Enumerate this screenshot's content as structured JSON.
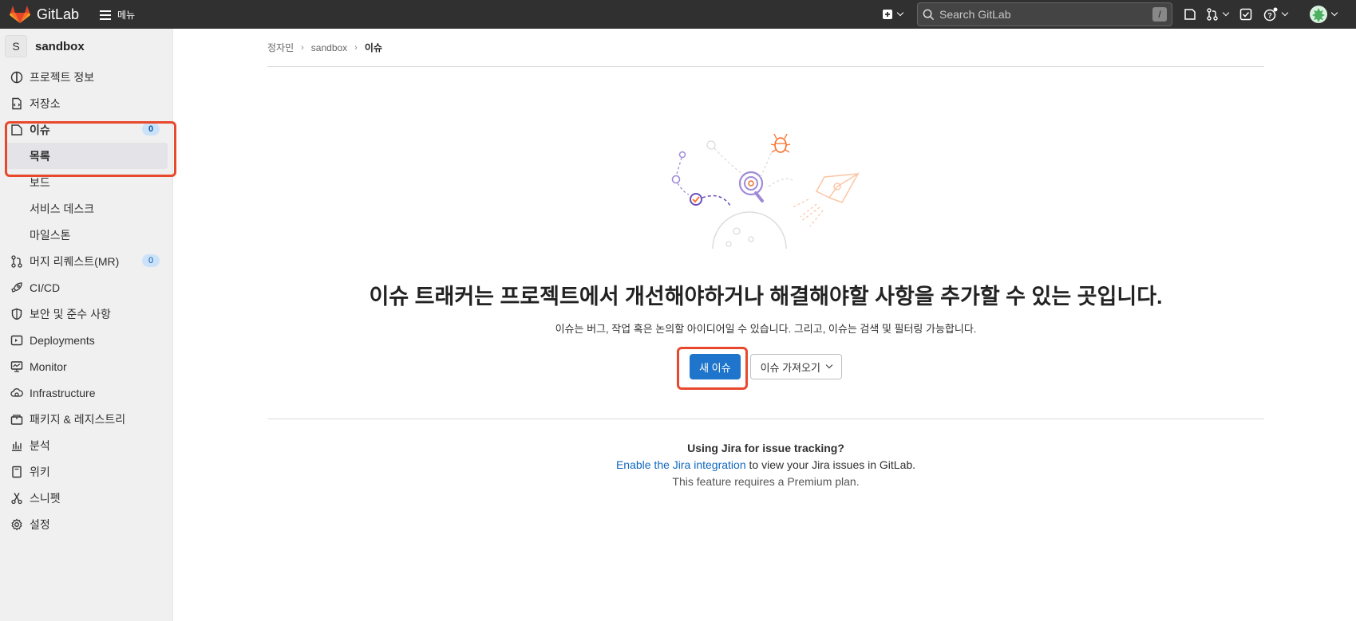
{
  "topbar": {
    "logo_text": "GitLab",
    "menu_label": "메뉴",
    "search_placeholder": "Search GitLab",
    "search_shortcut": "/"
  },
  "sidebar": {
    "project_initial": "S",
    "project_name": "sandbox",
    "items": [
      {
        "label": "프로젝트 정보",
        "icon": "project-info-icon"
      },
      {
        "label": "저장소",
        "icon": "repository-icon"
      },
      {
        "label": "이슈",
        "icon": "issues-icon",
        "badge": "0"
      },
      {
        "label": "목록"
      },
      {
        "label": "보드"
      },
      {
        "label": "서비스 데스크"
      },
      {
        "label": "마일스톤"
      },
      {
        "label": "머지 리퀘스트(MR)",
        "icon": "merge-request-icon",
        "badge": "0"
      },
      {
        "label": "CI/CD",
        "icon": "rocket-icon"
      },
      {
        "label": "보안 및 준수 사항",
        "icon": "shield-icon"
      },
      {
        "label": "Deployments",
        "icon": "deployments-icon"
      },
      {
        "label": "Monitor",
        "icon": "monitor-icon"
      },
      {
        "label": "Infrastructure",
        "icon": "cloud-gear-icon"
      },
      {
        "label": "패키지 & 레지스트리",
        "icon": "package-icon"
      },
      {
        "label": "분석",
        "icon": "chart-icon"
      },
      {
        "label": "위키",
        "icon": "book-icon"
      },
      {
        "label": "스니펫",
        "icon": "scissors-icon"
      },
      {
        "label": "설정",
        "icon": "gear-icon"
      }
    ]
  },
  "breadcrumb": [
    "정자민",
    "sandbox",
    "이슈"
  ],
  "empty_state": {
    "title": "이슈 트래커는 프로젝트에서 개선해야하거나 해결해야할 사항을 추가할 수 있는 곳입니다.",
    "description": "이슈는 버그, 작업 혹은 논의할 아이디어일 수 있습니다. 그리고, 이슈는 검색 및 필터링 가능합니다.",
    "new_issue_label": "새 이슈",
    "import_label": "이슈 가져오기"
  },
  "jira": {
    "question": "Using Jira for issue tracking?",
    "link": "Enable the Jira integration",
    "rest": " to view your Jira issues in GitLab.",
    "note": "This feature requires a Premium plan."
  },
  "colors": {
    "topbar": "#303030",
    "primary": "#1f75cb",
    "highlight": "#e8492d",
    "link": "#1068bf"
  }
}
